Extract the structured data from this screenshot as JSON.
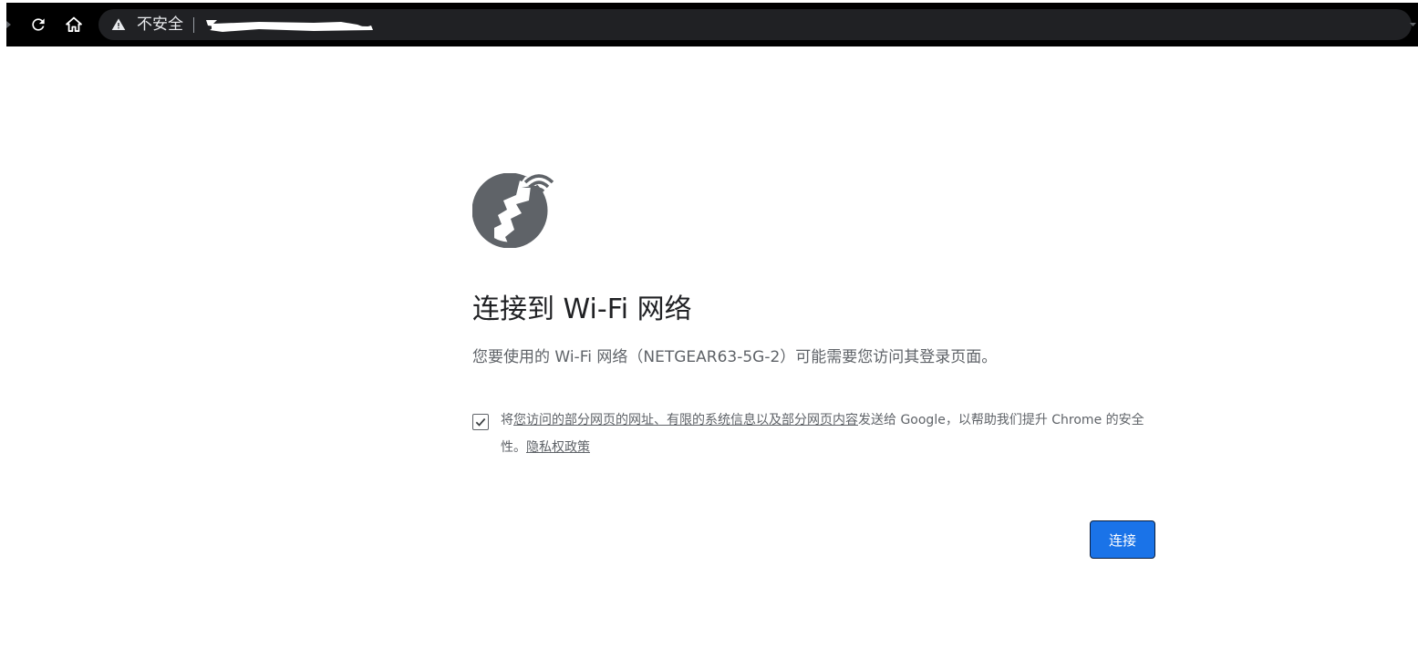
{
  "browser": {
    "security_label": "不安全",
    "icons": {
      "reload": "reload-icon",
      "home": "home-icon",
      "security": "warning-triangle-icon"
    }
  },
  "interstitial": {
    "icon": "wifi-globe-icon",
    "heading": "连接到 Wi-Fi 网络",
    "description": "您要使用的 Wi-Fi 网络（NETGEAR63-5G-2）可能需要您访问其登录页面。",
    "optin": {
      "checked": true,
      "prefix": "将",
      "link_text": "您访问的部分网页的网址、有限的系统信息以及部分网页内容",
      "suffix": "发送给 Google，以帮助我们提升 Chrome 的安全性。",
      "privacy_link": "隐私权政策"
    },
    "connect_button": "连接"
  },
  "colors": {
    "primary_button": "#1a73e8",
    "heading_text": "#202124",
    "body_text": "#5f6368",
    "icon": "#5f6368"
  }
}
